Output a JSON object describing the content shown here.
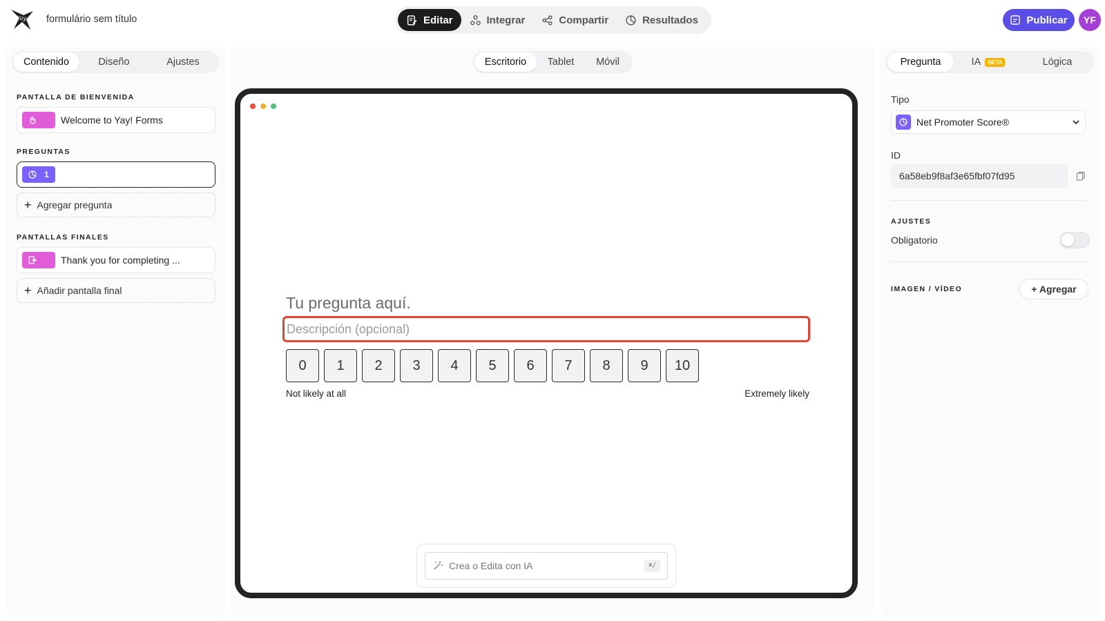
{
  "header": {
    "form_title": "formulário sem título",
    "modes": [
      {
        "label": "Editar",
        "icon": "edit-icon",
        "active": true
      },
      {
        "label": "Integrar",
        "icon": "integrate-icon",
        "active": false
      },
      {
        "label": "Compartir",
        "icon": "share-icon",
        "active": false
      },
      {
        "label": "Resultados",
        "icon": "results-icon",
        "active": false
      }
    ],
    "publish_label": "Publicar",
    "avatar_initials": "YF"
  },
  "left_panel": {
    "tabs": [
      {
        "label": "Contenido",
        "active": true
      },
      {
        "label": "Diseño",
        "active": false
      },
      {
        "label": "Ajustes",
        "active": false
      }
    ],
    "welcome_label": "PANTALLA DE BIENVENIDA",
    "welcome_item": "Welcome to Yay! Forms",
    "questions_label": "PREGUNTAS",
    "question_number": "1",
    "add_question": "Agregar pregunta",
    "endings_label": "PANTALLAS FINALES",
    "ending_item": "Thank you for completing ...",
    "add_ending": "Añadir pantalla final"
  },
  "preview": {
    "devices": [
      {
        "label": "Escritorio",
        "active": true
      },
      {
        "label": "Tablet",
        "active": false
      },
      {
        "label": "Móvil",
        "active": false
      }
    ],
    "question_title": "Tu pregunta aquí.",
    "description_placeholder": "Descripción (opcional)",
    "scale": [
      "0",
      "1",
      "2",
      "3",
      "4",
      "5",
      "6",
      "7",
      "8",
      "9",
      "10"
    ],
    "low_label": "Not likely at all",
    "high_label": "Extremely likely",
    "ai_placeholder": "Crea o Edita con IA",
    "ai_shortcut": "⌘/"
  },
  "right_panel": {
    "tabs": [
      {
        "label": "Pregunta",
        "active": true
      },
      {
        "label": "IA",
        "active": false
      },
      {
        "label": "Lógica",
        "active": false
      }
    ],
    "beta_badge": "BETA",
    "type_label": "Tipo",
    "type_value": "Net Promoter Score®",
    "id_label": "ID",
    "id_value": "6a58eb9f8af3e65fbf07fd95",
    "settings_label": "AJUSTES",
    "required_label": "Obligatorio",
    "required_on": false,
    "media_label": "IMAGEN / VÍDEO",
    "add_media": "+ Agregar"
  },
  "colors": {
    "accent": "#5b4ee6",
    "avatar": "#a53fd8",
    "chip_pink": "#e05cd8",
    "chip_purple": "#7b61ff",
    "error_outline": "#e2452f",
    "dot_red": "#ee4f3a",
    "dot_yellow": "#f2b02a",
    "dot_green": "#52c07a"
  }
}
